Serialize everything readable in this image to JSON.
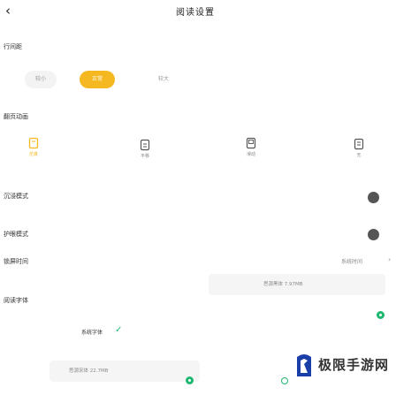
{
  "header": {
    "title": "阅读设置",
    "back_icon": "chevron-left-icon"
  },
  "line_spacing": {
    "label": "行间距",
    "options": [
      "较小",
      "正常",
      "较大"
    ],
    "selected": "正常"
  },
  "page_turn": {
    "label": "翻页动画",
    "modes": [
      {
        "label": "仿真",
        "icon": "book-icon",
        "selected": true
      },
      {
        "label": "平移",
        "icon": "pages-icon",
        "selected": false
      },
      {
        "label": "滑动",
        "icon": "slide-icon",
        "selected": false
      },
      {
        "label": "无",
        "icon": "none-icon",
        "selected": false
      }
    ]
  },
  "immersive": {
    "label": "沉浸模式"
  },
  "eye_protection": {
    "label": "护眼模式"
  },
  "lock_time": {
    "label": "锁屏时间",
    "value": "系统时间"
  },
  "font": {
    "label": "阅读字体",
    "system_font": "系统字体",
    "option_a": "思源黑体 7.97MB",
    "option_b": "思源宋体 22.7MB"
  },
  "colors": {
    "accent": "#f6b820",
    "check": "#1fb870"
  },
  "watermark": {
    "text": "极限手游网"
  }
}
